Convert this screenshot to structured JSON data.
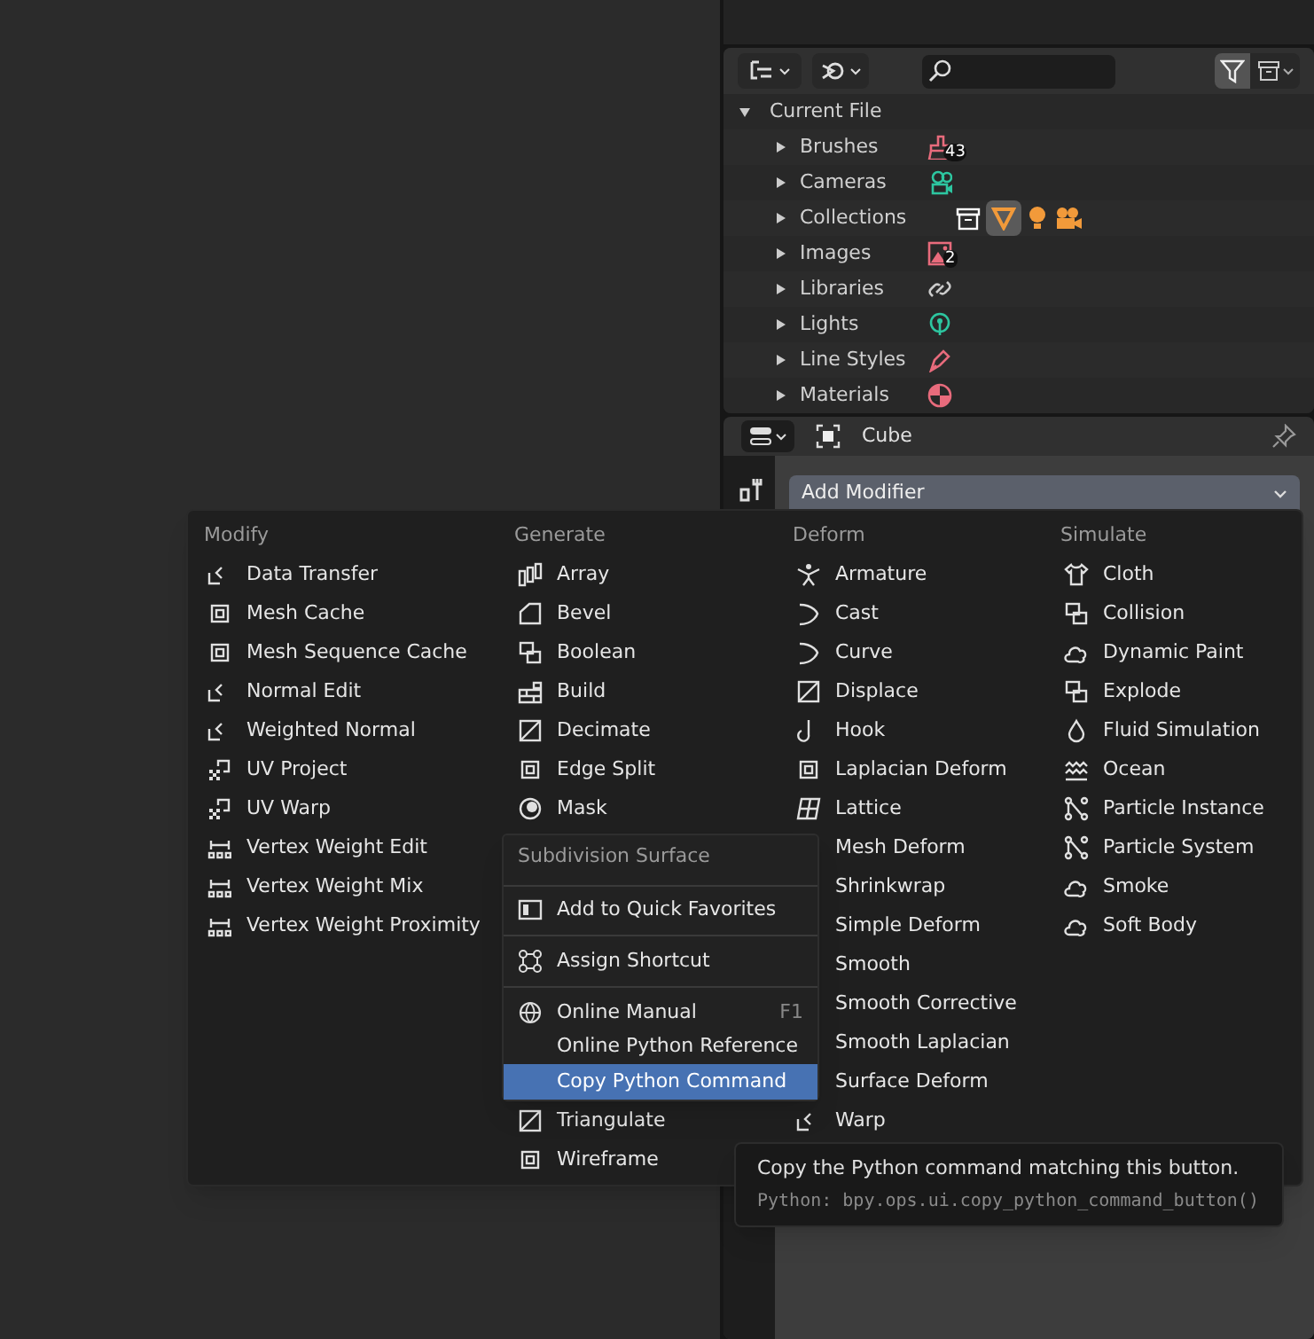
{
  "outliner": {
    "root": {
      "label": "Current File",
      "expanded": true
    },
    "items": [
      {
        "label": "Brushes",
        "badge": "43",
        "expanded": false
      },
      {
        "label": "Cameras",
        "expanded": false
      },
      {
        "label": "Collections",
        "expanded": false
      },
      {
        "label": "Images",
        "badge": "2",
        "expanded": false
      },
      {
        "label": "Libraries",
        "expanded": false
      },
      {
        "label": "Lights",
        "expanded": false
      },
      {
        "label": "Line Styles",
        "expanded": false
      },
      {
        "label": "Materials",
        "expanded": false
      }
    ]
  },
  "properties": {
    "object_name": "Cube",
    "add_modifier": "Add Modifier"
  },
  "modifier_menu": {
    "columns": [
      {
        "title": "Modify",
        "items": [
          "Data Transfer",
          "Mesh Cache",
          "Mesh Sequence Cache",
          "Normal Edit",
          "Weighted Normal",
          "UV Project",
          "UV Warp",
          "Vertex Weight Edit",
          "Vertex Weight Mix",
          "Vertex Weight Proximity"
        ]
      },
      {
        "title": "Generate",
        "items": [
          "Array",
          "Bevel",
          "Boolean",
          "Build",
          "Decimate",
          "Edge Split",
          "Mask"
        ],
        "items_below_overlay": [
          "Triangulate",
          "Wireframe"
        ]
      },
      {
        "title": "Deform",
        "items": [
          "Armature",
          "Cast",
          "Curve",
          "Displace",
          "Hook",
          "Laplacian Deform",
          "Lattice",
          "Mesh Deform",
          "Shrinkwrap",
          "Simple Deform",
          "Smooth",
          "Smooth Corrective",
          "Smooth Laplacian",
          "Surface Deform",
          "Warp"
        ]
      },
      {
        "title": "Simulate",
        "items": [
          "Cloth",
          "Collision",
          "Dynamic Paint",
          "Explode",
          "Fluid Simulation",
          "Ocean",
          "Particle Instance",
          "Particle System",
          "Smoke",
          "Soft Body"
        ]
      }
    ]
  },
  "context_menu": {
    "title": "Subdivision Surface",
    "groups": [
      [
        {
          "label": "Add to Quick Favorites",
          "selected": false
        }
      ],
      [
        {
          "label": "Assign Shortcut",
          "selected": false
        }
      ],
      [
        {
          "label": "Online Manual",
          "shortcut": "F1",
          "selected": false
        },
        {
          "label": "Online Python Reference",
          "selected": false
        },
        {
          "label": "Copy Python Command",
          "selected": true
        }
      ]
    ]
  },
  "tooltip": {
    "description": "Copy the Python command matching this button.",
    "python": "Python: bpy.ops.ui.copy_python_command_button()"
  }
}
